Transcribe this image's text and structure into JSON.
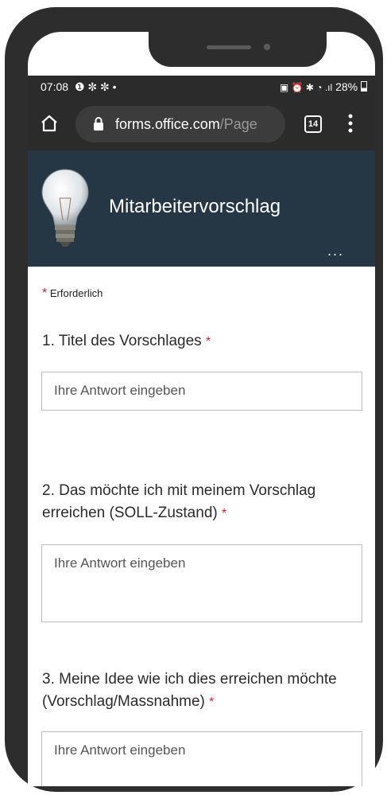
{
  "status_bar": {
    "time": "07:08",
    "left_icons": "❶ ✼ ✼ •",
    "right_icons": "▣ ⏰ ✱ ◔ .ıl",
    "battery": "28%"
  },
  "browser": {
    "url_domain": "forms.office.com",
    "url_path": "/Page",
    "tab_count": "14"
  },
  "form": {
    "title": "Mitarbeitervorschlag",
    "more": "...",
    "required_note": "Erforderlich",
    "required_marker": "*",
    "questions": [
      {
        "label": "1. Titel des Vorschlages",
        "placeholder": "Ihre Antwort eingeben"
      },
      {
        "label": "2. Das möchte ich mit meinem Vorschlag erreichen (SOLL-Zustand)",
        "placeholder": "Ihre Antwort eingeben"
      },
      {
        "label": "3. Meine Idee wie ich dies erreichen möchte (Vorschlag/Massnahme)",
        "placeholder": "Ihre Antwort eingeben"
      }
    ]
  },
  "colors": {
    "header_bg": "#253645",
    "browser_bg": "#2b2b2b",
    "required_red": "#c4262e"
  }
}
